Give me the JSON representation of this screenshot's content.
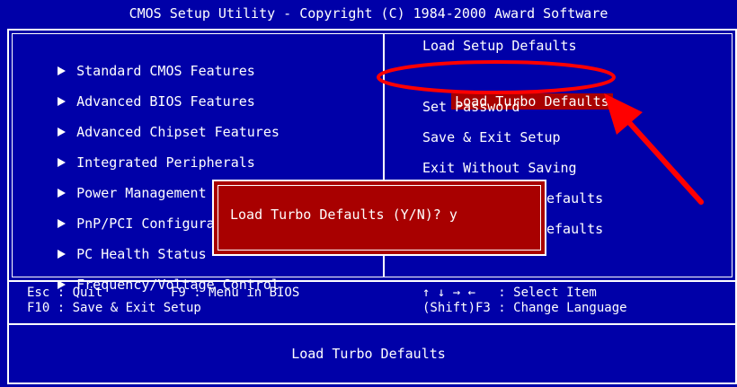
{
  "title": "CMOS Setup Utility - Copyright (C) 1984-2000 Award Software",
  "left_menu": [
    "Standard CMOS Features",
    "Advanced BIOS Features",
    "Advanced Chipset Features",
    "Integrated Peripherals",
    "Power Management Setup",
    "PnP/PCI Configura",
    "PC Health Status",
    "Frequency/Voltage Control"
  ],
  "right_menu": {
    "load_setup_defaults": "Load Setup Defaults",
    "load_turbo_defaults": "Load Turbo Defaults",
    "set_password": "Set Password",
    "save_exit": "Save & Exit Setup",
    "exit_no_save": "Exit Without Saving",
    "hidden_1": "efaults",
    "hidden_2": "efaults"
  },
  "help": {
    "esc": "Esc : Quit",
    "f9": "F9 : Menu in BIOS",
    "f10": "F10 : Save & Exit Setup",
    "arrows": "↑ ↓ → ←   : Select Item",
    "shift_f3": "(Shift)F3 : Change Language"
  },
  "status_line": "Load Turbo Defaults",
  "dialog": {
    "prompt": "Load Turbo Defaults (Y/N)? y"
  },
  "colors": {
    "bios_blue": "#0000a8",
    "highlight_red": "#a80000",
    "annotation_red": "#ff0000"
  }
}
